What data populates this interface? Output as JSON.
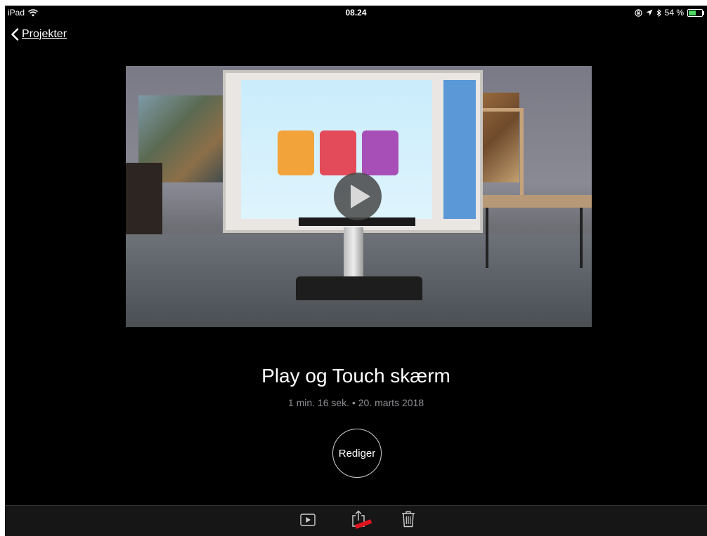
{
  "status_bar": {
    "device": "iPad",
    "time": "08.24",
    "battery_text": "54 %",
    "battery_level": 0.54
  },
  "nav": {
    "back_label": "Projekter"
  },
  "project": {
    "title": "Play og Touch skærm",
    "meta": "1 min. 16 sek. • 20. marts 2018"
  },
  "actions": {
    "edit_label": "Rediger"
  },
  "toolbar": {
    "items": [
      "play-icon",
      "share-icon",
      "trash-icon"
    ]
  },
  "colors": {
    "background": "#000000",
    "battery_fill": "#4cd964",
    "annotation_arrow": "#e0141e"
  }
}
